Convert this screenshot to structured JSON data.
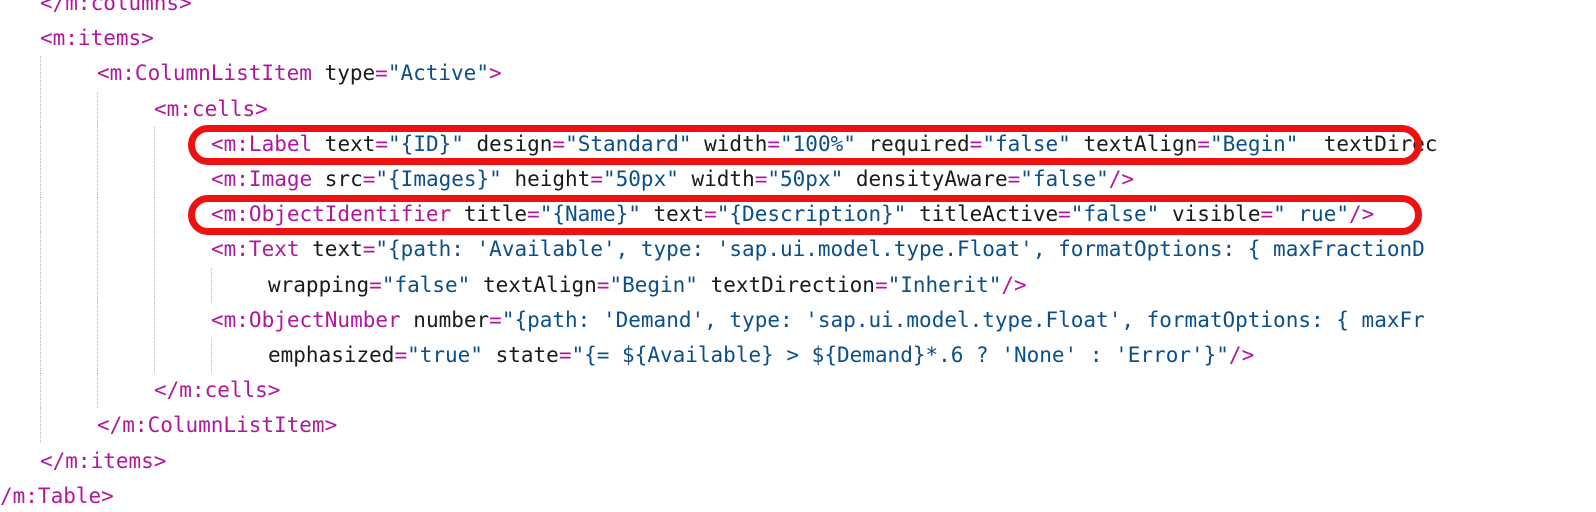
{
  "lines": [
    {
      "indent": 1,
      "tokens": [
        {
          "k": "tag",
          "v": "</m:columns>"
        }
      ]
    },
    {
      "indent": 1,
      "tokens": [
        {
          "k": "tag",
          "v": "<m:items>"
        }
      ]
    },
    {
      "indent": 2,
      "tokens": [
        {
          "k": "tag",
          "v": "<m:ColumnListItem"
        },
        {
          "k": "attr",
          "v": " type"
        },
        {
          "k": "eq",
          "v": "="
        },
        {
          "k": "val",
          "v": "\"Active\""
        },
        {
          "k": "tag",
          "v": ">"
        }
      ]
    },
    {
      "indent": 3,
      "tokens": [
        {
          "k": "tag",
          "v": "<m:cells>"
        }
      ]
    },
    {
      "indent": 4,
      "tokens": [
        {
          "k": "tag",
          "v": "<m:Label"
        },
        {
          "k": "attr",
          "v": " text"
        },
        {
          "k": "eq",
          "v": "="
        },
        {
          "k": "val",
          "v": "\"{ID}\""
        },
        {
          "k": "attr",
          "v": " design"
        },
        {
          "k": "eq",
          "v": "="
        },
        {
          "k": "val",
          "v": "\"Standard\""
        },
        {
          "k": "attr",
          "v": " width"
        },
        {
          "k": "eq",
          "v": "="
        },
        {
          "k": "val",
          "v": "\"100%\""
        },
        {
          "k": "attr",
          "v": " required"
        },
        {
          "k": "eq",
          "v": "="
        },
        {
          "k": "val",
          "v": "\"false\""
        },
        {
          "k": "attr",
          "v": " textAlign"
        },
        {
          "k": "eq",
          "v": "="
        },
        {
          "k": "val",
          "v": "\"Begin\""
        },
        {
          "k": "attr",
          "v": "  textDirec"
        }
      ]
    },
    {
      "indent": 4,
      "tokens": [
        {
          "k": "tag",
          "v": "<m:Image"
        },
        {
          "k": "attr",
          "v": " src"
        },
        {
          "k": "eq",
          "v": "="
        },
        {
          "k": "val",
          "v": "\"{Images}\""
        },
        {
          "k": "attr",
          "v": " height"
        },
        {
          "k": "eq",
          "v": "="
        },
        {
          "k": "val",
          "v": "\"50px\""
        },
        {
          "k": "attr",
          "v": " width"
        },
        {
          "k": "eq",
          "v": "="
        },
        {
          "k": "val",
          "v": "\"50px\""
        },
        {
          "k": "attr",
          "v": " densityAware"
        },
        {
          "k": "eq",
          "v": "="
        },
        {
          "k": "val",
          "v": "\"false\""
        },
        {
          "k": "tag",
          "v": "/>"
        }
      ]
    },
    {
      "indent": 4,
      "tokens": [
        {
          "k": "tag",
          "v": "<m:ObjectIdentifier"
        },
        {
          "k": "attr",
          "v": " title"
        },
        {
          "k": "eq",
          "v": "="
        },
        {
          "k": "val",
          "v": "\"{Name}\""
        },
        {
          "k": "attr",
          "v": " text"
        },
        {
          "k": "eq",
          "v": "="
        },
        {
          "k": "val",
          "v": "\"{Description}\""
        },
        {
          "k": "attr",
          "v": " titleActive"
        },
        {
          "k": "eq",
          "v": "="
        },
        {
          "k": "val",
          "v": "\"false\""
        },
        {
          "k": "attr",
          "v": " visible"
        },
        {
          "k": "eq",
          "v": "="
        },
        {
          "k": "val",
          "v": "\" rue\""
        },
        {
          "k": "tag",
          "v": "/>"
        }
      ]
    },
    {
      "indent": 4,
      "tokens": [
        {
          "k": "tag",
          "v": "<m:Text"
        },
        {
          "k": "attr",
          "v": " text"
        },
        {
          "k": "eq",
          "v": "="
        },
        {
          "k": "val",
          "v": "\"{path: 'Available', type: 'sap.ui.model.type.Float', formatOptions: { maxFractionD"
        }
      ]
    },
    {
      "indent": 5,
      "tokens": [
        {
          "k": "attr",
          "v": "wrapping"
        },
        {
          "k": "eq",
          "v": "="
        },
        {
          "k": "val",
          "v": "\"false\""
        },
        {
          "k": "attr",
          "v": " textAlign"
        },
        {
          "k": "eq",
          "v": "="
        },
        {
          "k": "val",
          "v": "\"Begin\""
        },
        {
          "k": "attr",
          "v": " textDirection"
        },
        {
          "k": "eq",
          "v": "="
        },
        {
          "k": "val",
          "v": "\"Inherit\""
        },
        {
          "k": "tag",
          "v": "/>"
        }
      ]
    },
    {
      "indent": 4,
      "tokens": [
        {
          "k": "tag",
          "v": "<m:ObjectNumber"
        },
        {
          "k": "attr",
          "v": " number"
        },
        {
          "k": "eq",
          "v": "="
        },
        {
          "k": "val",
          "v": "\"{path: 'Demand', type: 'sap.ui.model.type.Float', formatOptions: { maxFr"
        }
      ]
    },
    {
      "indent": 5,
      "tokens": [
        {
          "k": "attr",
          "v": "emphasized"
        },
        {
          "k": "eq",
          "v": "="
        },
        {
          "k": "val",
          "v": "\"true\""
        },
        {
          "k": "attr",
          "v": " state"
        },
        {
          "k": "eq",
          "v": "="
        },
        {
          "k": "val",
          "v": "\"{= ${Available} > ${Demand}*.6 ? 'None' : 'Error'}\""
        },
        {
          "k": "tag",
          "v": "/>"
        }
      ]
    },
    {
      "indent": 3,
      "tokens": [
        {
          "k": "tag",
          "v": "</m:cells>"
        }
      ]
    },
    {
      "indent": 2,
      "tokens": [
        {
          "k": "tag",
          "v": "</m:ColumnListItem>"
        }
      ]
    },
    {
      "indent": 1,
      "tokens": [
        {
          "k": "tag",
          "v": "</m:items>"
        }
      ]
    },
    {
      "indent": 0,
      "tokens": [
        {
          "k": "tag",
          "v": "/m:Table>"
        }
      ]
    }
  ],
  "highlights": [
    {
      "line": 4,
      "label": "label-line"
    },
    {
      "line": 6,
      "label": "object-identifier-line"
    }
  ]
}
